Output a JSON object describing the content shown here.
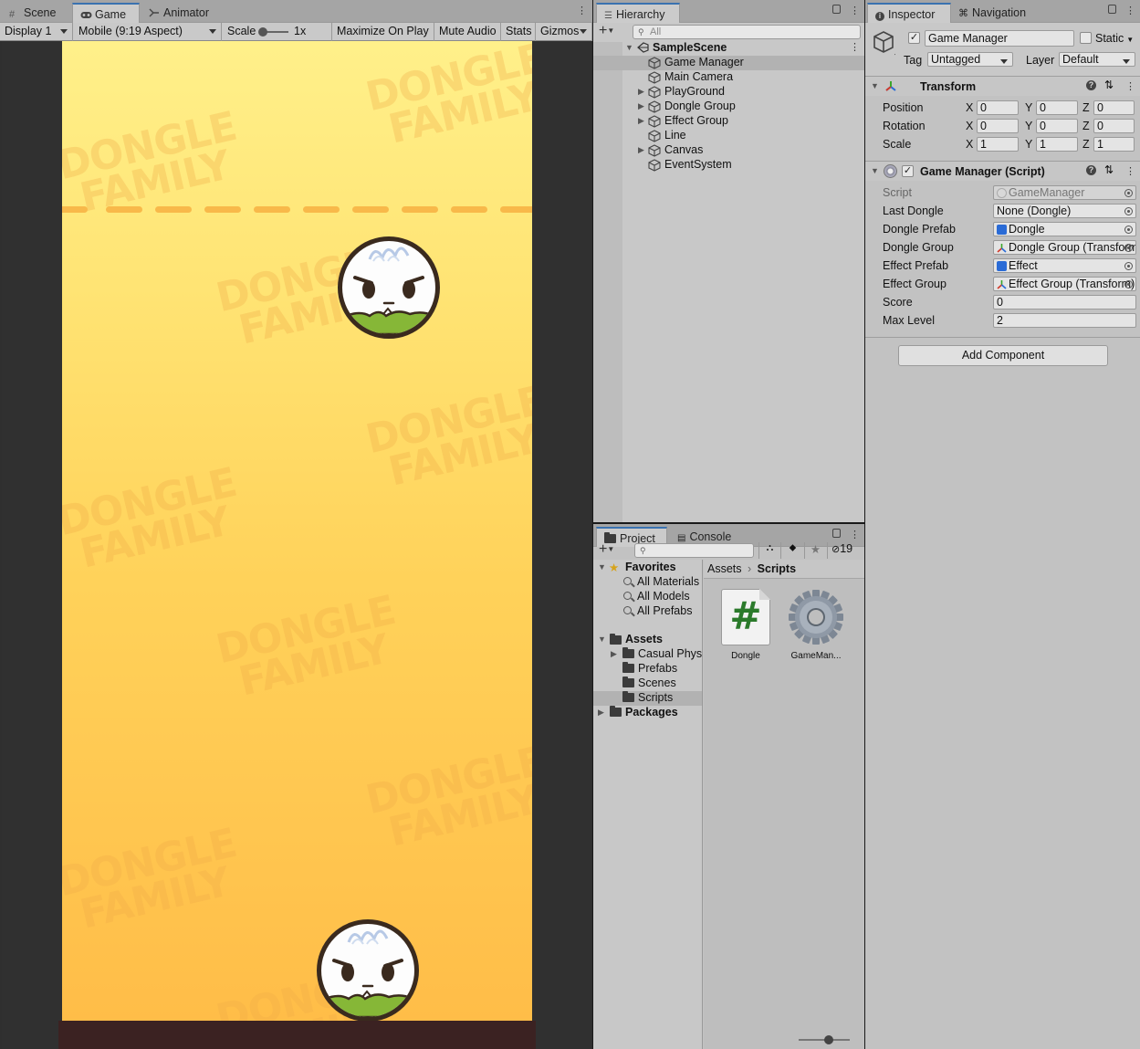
{
  "game_view": {
    "tabs": [
      {
        "label": "Scene",
        "icon": "grid-icon"
      },
      {
        "label": "Game",
        "icon": "gamepad-icon"
      },
      {
        "label": "Animator",
        "icon": "animator-icon"
      }
    ],
    "toolbar": {
      "display": "Display 1",
      "aspect": "Mobile (9:19 Aspect)",
      "scale_label": "Scale",
      "scale_value": "1x",
      "scale_slider_fraction": 0.0,
      "maximize": "Maximize On Play",
      "mute": "Mute Audio",
      "stats": "Stats",
      "gizmos": "Gizmos"
    },
    "watermark": [
      "DONGLE",
      "FAMILY"
    ],
    "colors": {
      "sky_top": "#fff08a",
      "sky_bottom": "#ffbd48",
      "line": "#f8b94a",
      "floor": "#3b2222"
    }
  },
  "hierarchy": {
    "tab_label": "Hierarchy",
    "search_placeholder": "All",
    "scene_name": "SampleScene",
    "items": [
      {
        "label": "Game Manager",
        "expandable": false,
        "selected": true
      },
      {
        "label": "Main Camera",
        "expandable": false
      },
      {
        "label": "PlayGround",
        "expandable": true
      },
      {
        "label": "Dongle Group",
        "expandable": true
      },
      {
        "label": "Effect Group",
        "expandable": true
      },
      {
        "label": "Line",
        "expandable": false
      },
      {
        "label": "Canvas",
        "expandable": true
      },
      {
        "label": "EventSystem",
        "expandable": false
      }
    ]
  },
  "project": {
    "tabs": [
      "Project",
      "Console"
    ],
    "hidden_count": "19",
    "favorites_label": "Favorites",
    "favorites": [
      "All Materials",
      "All Models",
      "All Prefabs"
    ],
    "assets_label": "Assets",
    "asset_folders": [
      {
        "label": "Casual Phys",
        "expandable": true
      },
      {
        "label": "Prefabs"
      },
      {
        "label": "Scenes"
      },
      {
        "label": "Scripts",
        "selected": true
      }
    ],
    "packages_label": "Packages",
    "breadcrumb": [
      "Assets",
      "Scripts"
    ],
    "files": [
      {
        "label": "Dongle",
        "icon": "csharp-script-icon"
      },
      {
        "label": "GameMan...",
        "icon": "gear-icon"
      }
    ]
  },
  "inspector": {
    "tabs": [
      "Inspector",
      "Navigation"
    ],
    "object_name": "Game Manager",
    "active": true,
    "static_label": "Static",
    "tag_label": "Tag",
    "tag_value": "Untagged",
    "layer_label": "Layer",
    "layer_value": "Default",
    "transform": {
      "title": "Transform",
      "rows": [
        {
          "label": "Position",
          "x": "0",
          "y": "0",
          "z": "0"
        },
        {
          "label": "Rotation",
          "x": "0",
          "y": "0",
          "z": "0"
        },
        {
          "label": "Scale",
          "x": "1",
          "y": "1",
          "z": "1"
        }
      ]
    },
    "script_component": {
      "title": "Game Manager (Script)",
      "fields": [
        {
          "label": "Script",
          "value": "GameManager",
          "disabled": true,
          "icon": "script-icon"
        },
        {
          "label": "Last Dongle",
          "value": "None (Dongle)"
        },
        {
          "label": "Dongle Prefab",
          "value": "Dongle",
          "icon": "prefab-icon"
        },
        {
          "label": "Dongle Group",
          "value": "Dongle Group (Transform)",
          "icon": "transform-icon"
        },
        {
          "label": "Effect Prefab",
          "value": "Effect",
          "icon": "prefab-icon"
        },
        {
          "label": "Effect Group",
          "value": "Effect Group (Transform)",
          "icon": "transform-icon"
        },
        {
          "label": "Score",
          "value": "0",
          "plain": true
        },
        {
          "label": "Max Level",
          "value": "2",
          "plain": true
        }
      ]
    },
    "add_component": "Add Component"
  }
}
